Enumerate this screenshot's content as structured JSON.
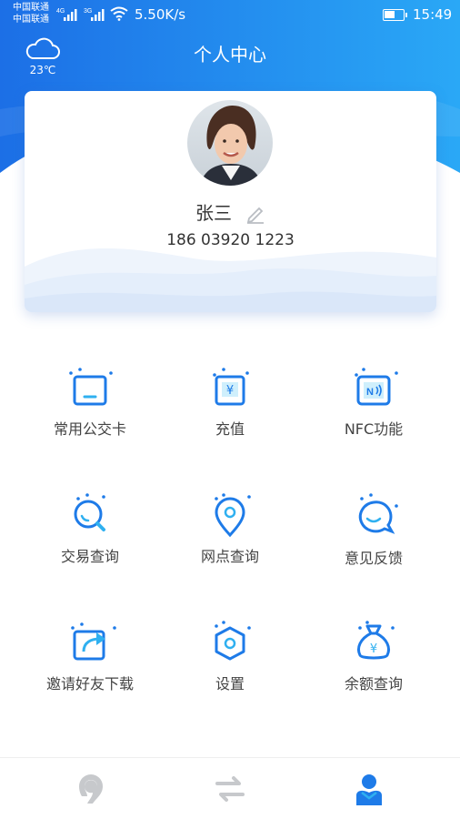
{
  "status_bar": {
    "carrier_1": "中国联通",
    "carrier_2": "中国联通",
    "net_1": "4G",
    "net_2": "3G",
    "speed": "5.50K/s",
    "time": "15:49",
    "battery_level": 0.6
  },
  "header": {
    "title": "个人中心",
    "weather_icon": "cloud-icon",
    "temperature": "23℃"
  },
  "profile": {
    "name": "张三",
    "phone": "186 03920 1223",
    "edit_icon": "pencil-icon"
  },
  "menu": [
    {
      "label": "常用公交卡",
      "icon": "bus-card-icon"
    },
    {
      "label": "充值",
      "icon": "recharge-icon"
    },
    {
      "label": "NFC功能",
      "icon": "nfc-icon"
    },
    {
      "label": "交易查询",
      "icon": "search-icon"
    },
    {
      "label": "网点查询",
      "icon": "location-pin-icon"
    },
    {
      "label": "意见反馈",
      "icon": "feedback-bubble-icon"
    },
    {
      "label": "邀请好友下载",
      "icon": "share-icon"
    },
    {
      "label": "设置",
      "icon": "settings-hexagon-icon"
    },
    {
      "label": "余额查询",
      "icon": "money-bag-icon"
    }
  ],
  "tabbar": [
    {
      "icon": "home-logo-icon",
      "active": false
    },
    {
      "icon": "transfer-icon",
      "active": false
    },
    {
      "icon": "profile-icon",
      "active": true
    }
  ],
  "colors": {
    "brand_blue": "#1a73e8",
    "header_light": "#2fa6f5",
    "icon_blue": "#1e7be8",
    "tab_inactive": "#c7c9cc"
  }
}
